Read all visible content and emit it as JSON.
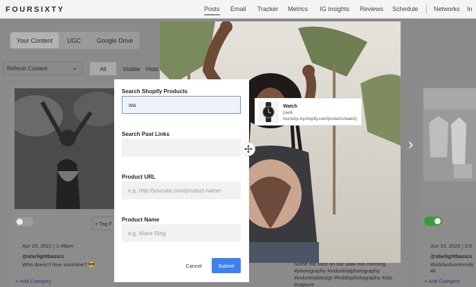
{
  "app": {
    "logo": "FOURSIXTY"
  },
  "nav": [
    {
      "label": "Posts"
    },
    {
      "label": "Email"
    },
    {
      "label": "Tracker"
    },
    {
      "label": "Metrics"
    },
    {
      "label": "IG Insights"
    },
    {
      "label": "Reviews"
    },
    {
      "label": "Schedule"
    },
    {
      "label": "Networks"
    },
    {
      "label": "In"
    }
  ],
  "content_tabs": [
    {
      "label": "Your Content"
    },
    {
      "label": "UGC"
    },
    {
      "label": "Google Drive"
    }
  ],
  "refresh": {
    "label": "Refresh Content"
  },
  "filters": [
    {
      "label": "All"
    },
    {
      "label": "Visible"
    },
    {
      "label": "Hidd"
    }
  ],
  "cards": {
    "left": {
      "tag_label": "+ Tag F",
      "date": "Apr 29, 2021 | 1:49pm",
      "user": "@starlightbasics",
      "caption": "Who doesn’t love sunshine? 😎",
      "add_category": "+ Add Category"
    },
    "right": {
      "date": "Jun 10, 2020 | 2:0",
      "user": "@starlightbasics",
      "caption": "#kidsfashiontrends #k",
      "add_category": "+ Add Category"
    }
  },
  "middle_caption": "Some old silos on our walk this morning. #photography #industrialphotography #industrialdesign #hobbyphotography #silo #capture",
  "modal": {
    "search_label": "Search Shopify Products",
    "search_value": "wa",
    "past_links_label": "Search Past Links",
    "past_links_value": "",
    "url_label": "Product URL",
    "url_placeholder": "e.g. http://yoursite.com/product-name/",
    "name_label": "Product Name",
    "name_placeholder": "e.g. Wave Ring",
    "cancel": "Cancel",
    "submit": "Submit"
  },
  "suggestion": {
    "title": "Watch",
    "url": "(swill-foursixty.myshopify.com/products/watch)"
  },
  "colors": {
    "accent": "#3f80ee",
    "toggle_on": "#3a9a3e",
    "link": "#2a3d7a"
  },
  "icons": {
    "close": "close-icon",
    "next": "chevron-right-icon",
    "move": "move-icon",
    "dropdown": "chevron-down-icon"
  }
}
